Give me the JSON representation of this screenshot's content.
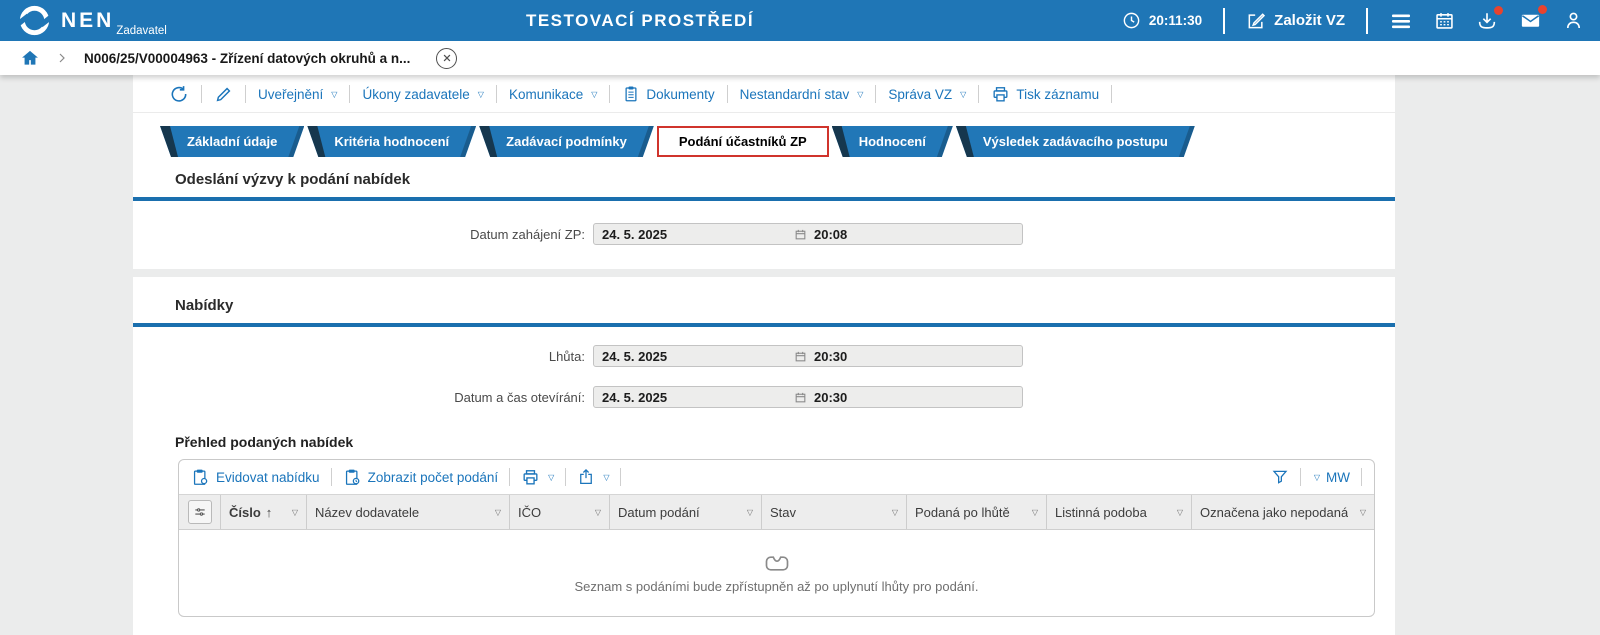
{
  "header": {
    "logo": "NEN",
    "logo_sub": "Zadavatel",
    "env_title": "TESTOVACÍ PROSTŘEDÍ",
    "time": "20:11:30",
    "new_vz": "Založit VZ"
  },
  "breadcrumb": {
    "current": "N006/25/V00004963 - Zřízení datových okruhů a n..."
  },
  "record_toolbar": {
    "uverejneni": "Uveřejnění",
    "ukony": "Úkony zadavatele",
    "komunikace": "Komunikace",
    "dokumenty": "Dokumenty",
    "nestandardni": "Nestandardní stav",
    "sprava": "Správa VZ",
    "tisk": "Tisk záznamu"
  },
  "tabs": [
    {
      "label": "Základní údaje",
      "active": false
    },
    {
      "label": "Kritéria hodnocení",
      "active": false
    },
    {
      "label": "Zadávací podmínky",
      "active": false
    },
    {
      "label": "Podání účastníků ZP",
      "active": true
    },
    {
      "label": "Hodnocení",
      "active": false
    },
    {
      "label": "Výsledek zadávacího postupu",
      "active": false
    }
  ],
  "section_vyzva": {
    "title": "Odeslání výzvy k podání nabídek",
    "field_label": "Datum zahájení ZP:",
    "date": "24. 5. 2025",
    "time": "20:08"
  },
  "section_nabidky": {
    "title": "Nabídky",
    "lhuta_label": "Lhůta:",
    "lhuta_date": "24. 5. 2025",
    "lhuta_time": "20:30",
    "otevirani_label": "Datum a čas otevírání:",
    "otevirani_date": "24. 5. 2025",
    "otevirani_time": "20:30",
    "table_title": "Přehled podaných nabídek"
  },
  "table": {
    "toolbar": {
      "evidovat": "Evidovat nabídku",
      "zobrazit": "Zobrazit počet podání",
      "mw": "MW"
    },
    "columns": [
      "Číslo",
      "Název dodavatele",
      "IČO",
      "Datum podání",
      "Stav",
      "Podaná po lhůtě",
      "Listinná podoba",
      "Označena jako nepodaná"
    ],
    "empty_message": "Seznam s podáními bude zpřístupněn až po uplynutí lhůty pro podání."
  },
  "colors": {
    "primary_blue": "#1f76b6",
    "link_blue": "#1b75bb",
    "tab_fold_navy": "#16374e",
    "active_tab_red": "#d0342c",
    "notification_red": "#e8432e"
  }
}
